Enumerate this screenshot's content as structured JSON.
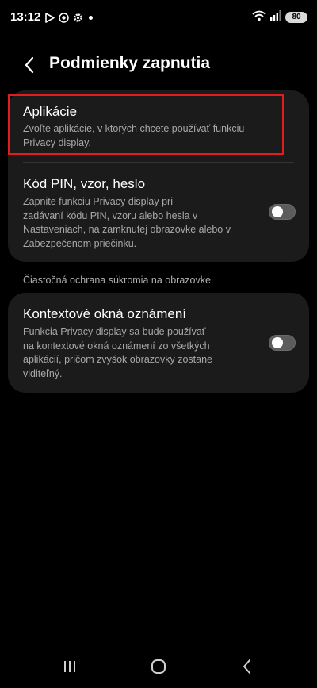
{
  "status_bar": {
    "time": "13:12",
    "battery": "80",
    "left_icons": [
      "play-store-icon",
      "chrome-icon",
      "settings-gear-icon",
      "dot-icon"
    ],
    "right_icons": [
      "wifi-icon",
      "signal-icon",
      "battery-icon"
    ]
  },
  "header": {
    "title": "Podmienky zapnutia",
    "back_icon": "chevron-left-icon"
  },
  "items": [
    {
      "title": "Aplikácie",
      "description_lines": [
        "Zvoľte aplikácie, v ktorých chcete používať funkciu",
        "Privacy display."
      ],
      "has_toggle": false,
      "highlighted": true
    },
    {
      "title": "Kód PIN, vzor, heslo",
      "description_lines": [
        "Zapnite funkciu Privacy display pri",
        "zadávaní kódu PIN, vzoru alebo hesla v",
        "Nastaveniach, na zamknutej obrazovke alebo v",
        "Zabezpečenom priečinku."
      ],
      "has_toggle": true,
      "toggle_on": false
    }
  ],
  "section_header": "Čiastočná ochrana súkromia na obrazovke",
  "section_items": [
    {
      "title": "Kontextové okná oznámení",
      "description_lines": [
        "Funkcia Privacy display sa bude používať",
        "na kontextové okná oznámení zo všetkých",
        "aplikácií, pričom zvyšok obrazovky zostane",
        "viditeľný."
      ],
      "has_toggle": true,
      "toggle_on": false
    }
  ],
  "colors": {
    "background": "#000000",
    "card": "#1b1b1b",
    "highlight_border": "#e01e1e",
    "secondary_text": "#a8a8a8",
    "toggle_off": "#5c5c5c"
  },
  "nav_bar": {
    "icons": [
      "recents-icon",
      "home-icon",
      "back-icon"
    ]
  }
}
